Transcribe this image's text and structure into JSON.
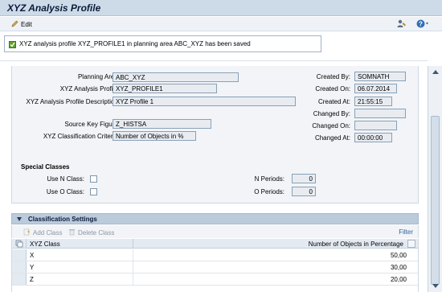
{
  "window": {
    "title": "XYZ Analysis Profile"
  },
  "toolbar": {
    "edit_label": "Edit"
  },
  "message": {
    "text": "XYZ analysis profile XYZ_PROFILE1 in planning area ABC_XYZ has been saved"
  },
  "form": {
    "planning_area": {
      "label": "Planning Area:",
      "value": "ABC_XYZ"
    },
    "analysis_profile": {
      "label": "XYZ Analysis Profile:",
      "value": "XYZ_PROFILE1"
    },
    "profile_description": {
      "label": "XYZ Analysis Profile Description:",
      "value": "XYZ Profile 1"
    },
    "source_key_figure": {
      "label": "Source Key Figure:",
      "value": "Z_HISTSA"
    },
    "classification_criteria": {
      "label": "XYZ Classification Criteria:",
      "value": "Number of Objects in %"
    },
    "created_by": {
      "label": "Created By:",
      "value": "SOMNATH"
    },
    "created_on": {
      "label": "Created On:",
      "value": "06.07.2014"
    },
    "created_at": {
      "label": "Created At:",
      "value": "21:55:15"
    },
    "changed_by": {
      "label": "Changed By:",
      "value": ""
    },
    "changed_on": {
      "label": "Changed On:",
      "value": ""
    },
    "changed_at": {
      "label": "Changed At:",
      "value": "00:00:00"
    }
  },
  "special_classes": {
    "title": "Special Classes",
    "use_n_class": {
      "label": "Use N Class:",
      "checked": false
    },
    "use_o_class": {
      "label": "Use O Class:",
      "checked": false
    },
    "n_periods": {
      "label": "N Periods:",
      "value": "0"
    },
    "o_periods": {
      "label": "O Periods:",
      "value": "0"
    }
  },
  "classification": {
    "title": "Classification Settings",
    "add_label": "Add Class",
    "delete_label": "Delete Class",
    "filter_label": "Filter",
    "columns": [
      "XYZ Class",
      "Number of Objects in Percentage"
    ],
    "rows": [
      {
        "cls": "X",
        "pct": "50,00"
      },
      {
        "cls": "Y",
        "pct": "30,00"
      },
      {
        "cls": "Z",
        "pct": "20,00"
      }
    ]
  },
  "colors": {
    "title_bg": "#cddbe8",
    "panel_bg": "#f2f4f7",
    "section_header_bg": "#bccbdb",
    "success": "#5fa12e"
  }
}
